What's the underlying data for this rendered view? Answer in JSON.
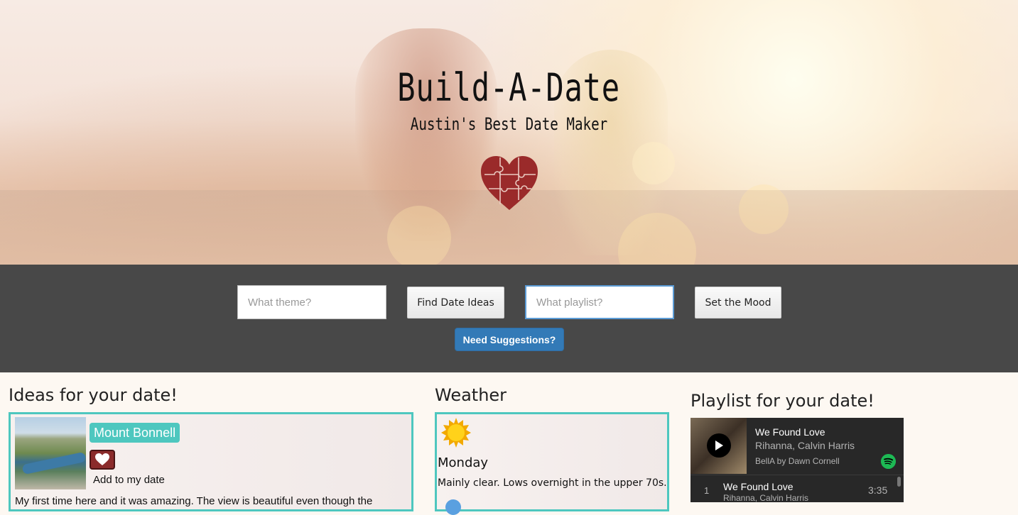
{
  "hero": {
    "title": "Build-A-Date",
    "subtitle": "Austin's Best Date Maker",
    "logo_icon": "puzzle-heart-icon"
  },
  "toolbar": {
    "theme_placeholder": "What theme?",
    "find_label": "Find Date Ideas",
    "playlist_placeholder": "What playlist?",
    "mood_label": "Set the Mood",
    "suggest_label": "Need Suggestions?"
  },
  "ideas": {
    "heading": "Ideas for your date!",
    "items": [
      {
        "name": "Mount Bonnell",
        "add_label": "Add to my date",
        "description": "My first time here and it was amazing. The view is beautiful even though the"
      }
    ]
  },
  "weather": {
    "heading": "Weather",
    "icon": "sun-icon",
    "day": "Monday",
    "description": "Mainly clear. Lows overnight in the upper 70s."
  },
  "playlist": {
    "heading": "Playlist for your date!",
    "now_playing": {
      "title": "We Found Love",
      "artist": "Rihanna, Calvin Harris",
      "owner": "BellA by Dawn Cornell"
    },
    "tracks": [
      {
        "num": "1",
        "title": "We Found Love",
        "artist": "Rihanna, Calvin Harris",
        "duration": "3:35"
      }
    ]
  },
  "colors": {
    "accent": "#4ec7bf",
    "toolbar": "#484848",
    "primary": "#337ab7",
    "heart": "#8b2b2b",
    "spotify": "#1db954"
  }
}
